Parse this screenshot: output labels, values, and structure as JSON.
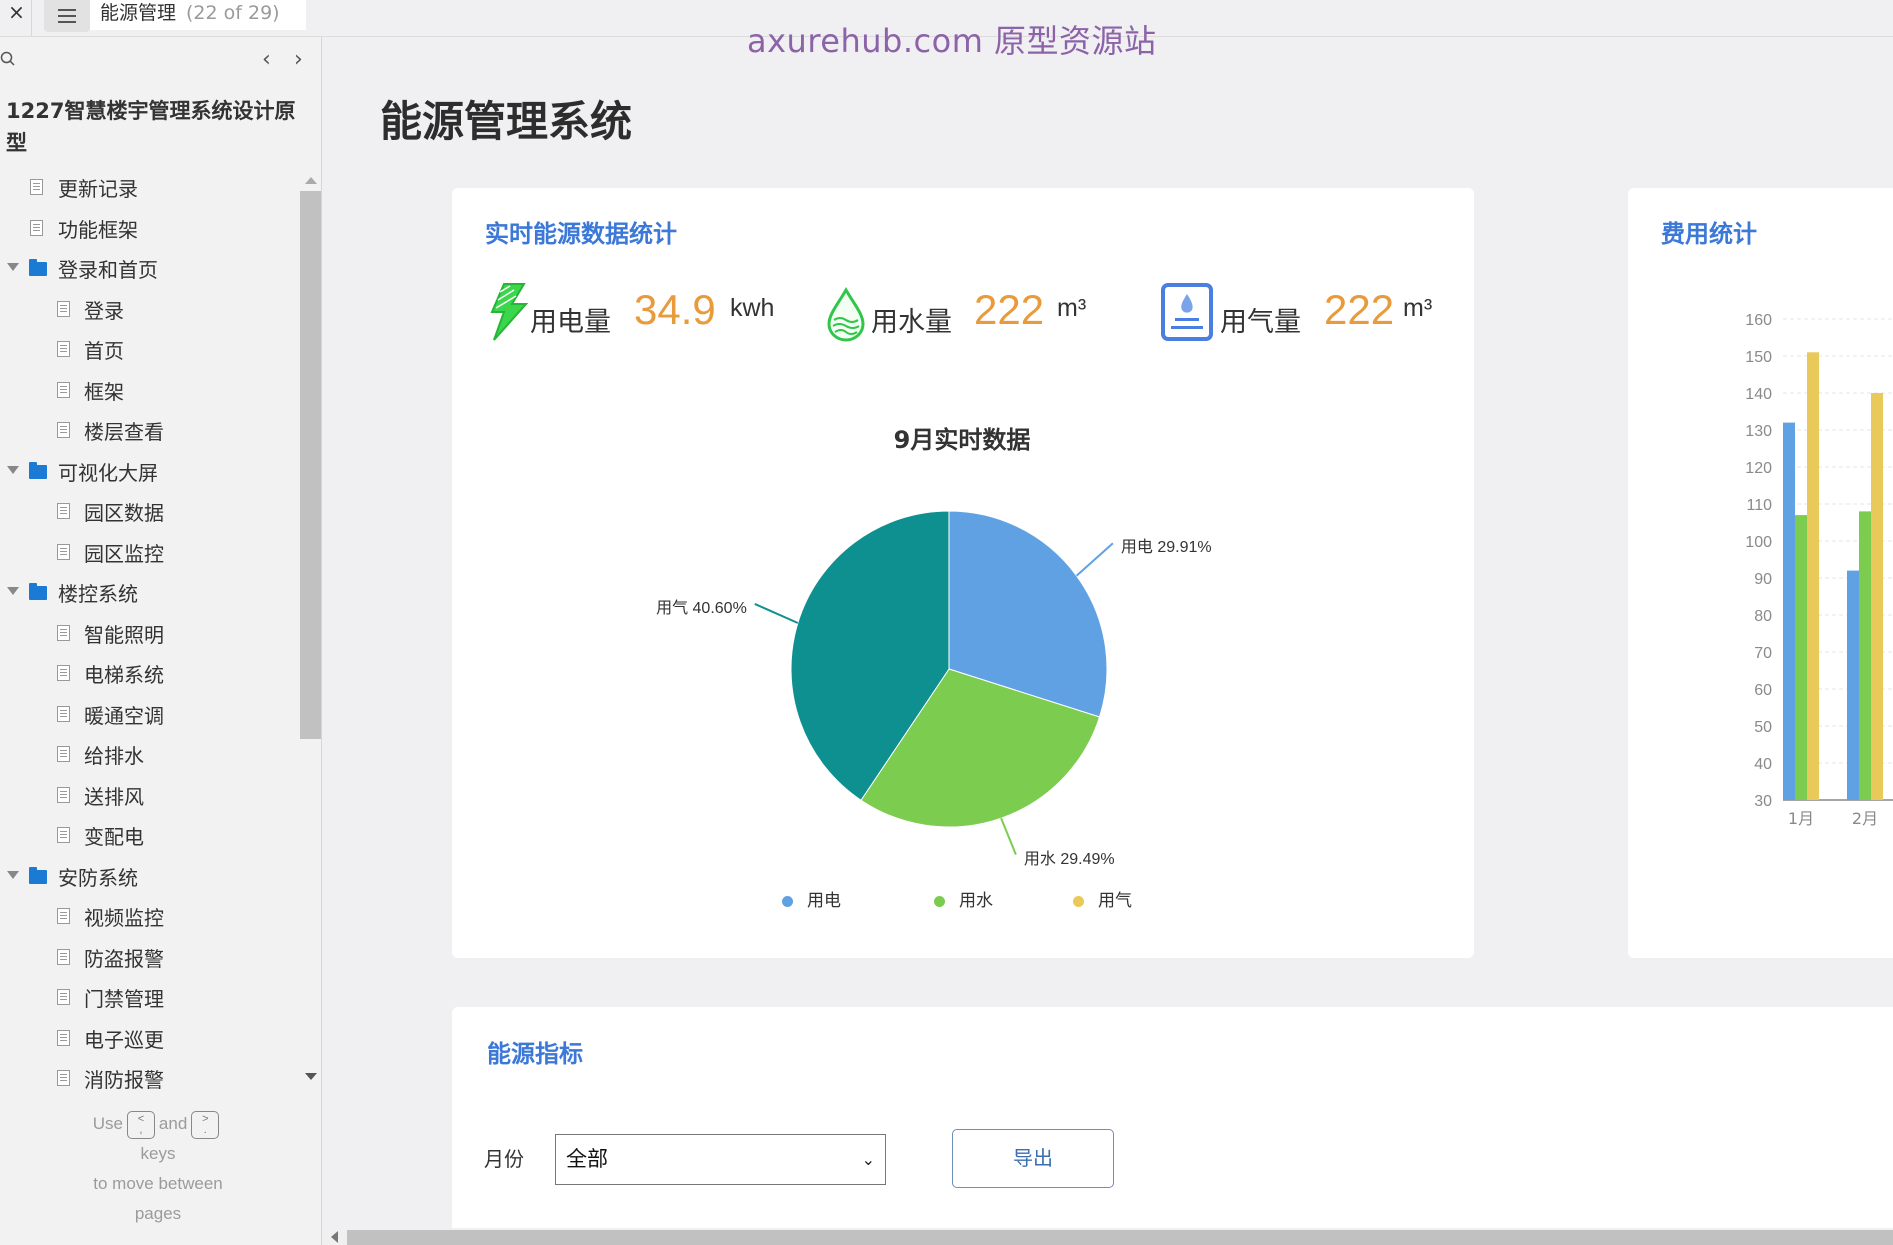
{
  "topbar": {
    "close_label": "×",
    "page_name": "能源管理",
    "page_count": "(22 of 29)",
    "watermark": "axurehub.com 原型资源站"
  },
  "sidebar": {
    "prev_label": "‹",
    "next_label": "›",
    "project_title": "1227智慧楼宇管理系统设计原型",
    "items": [
      {
        "label": "更新记录",
        "type": "page",
        "level": "top"
      },
      {
        "label": "功能框架",
        "type": "page",
        "level": "top"
      },
      {
        "label": "登录和首页",
        "type": "folder",
        "level": "top"
      },
      {
        "label": "登录",
        "type": "page",
        "level": "child"
      },
      {
        "label": "首页",
        "type": "page",
        "level": "child"
      },
      {
        "label": "框架",
        "type": "page",
        "level": "child"
      },
      {
        "label": "楼层查看",
        "type": "page",
        "level": "child"
      },
      {
        "label": "可视化大屏",
        "type": "folder",
        "level": "top"
      },
      {
        "label": "园区数据",
        "type": "page",
        "level": "child"
      },
      {
        "label": "园区监控",
        "type": "page",
        "level": "child"
      },
      {
        "label": "楼控系统",
        "type": "folder",
        "level": "top"
      },
      {
        "label": "智能照明",
        "type": "page",
        "level": "child"
      },
      {
        "label": "电梯系统",
        "type": "page",
        "level": "child"
      },
      {
        "label": "暖通空调",
        "type": "page",
        "level": "child"
      },
      {
        "label": "给排水",
        "type": "page",
        "level": "child"
      },
      {
        "label": "送排风",
        "type": "page",
        "level": "child"
      },
      {
        "label": "变配电",
        "type": "page",
        "level": "child"
      },
      {
        "label": "安防系统",
        "type": "folder",
        "level": "top"
      },
      {
        "label": "视频监控",
        "type": "page",
        "level": "child"
      },
      {
        "label": "防盗报警",
        "type": "page",
        "level": "child"
      },
      {
        "label": "门禁管理",
        "type": "page",
        "level": "child"
      },
      {
        "label": "电子巡更",
        "type": "page",
        "level": "child"
      },
      {
        "label": "消防报警",
        "type": "page",
        "level": "child"
      }
    ],
    "hint": {
      "use": "Use",
      "key_prev_top": "<",
      "key_prev_bottom": ",",
      "and": "and",
      "key_next_top": ">",
      "key_next_bottom": ".",
      "keys": "keys",
      "line2": "to move between",
      "line3": "pages"
    }
  },
  "main": {
    "title": "能源管理系统",
    "realtime_card": {
      "title": "实时能源数据统计",
      "stats": [
        {
          "icon": "lightning-icon",
          "name": "用电量",
          "value": "34.9",
          "unit": "kwh"
        },
        {
          "icon": "water-drop-icon",
          "name": "用水量",
          "value": "222",
          "unit": "m³"
        },
        {
          "icon": "gas-stove-icon",
          "name": "用气量",
          "value": "222",
          "unit": "m³"
        }
      ]
    },
    "cost_card": {
      "title": "费用统计"
    },
    "indicator_card": {
      "title": "能源指标",
      "month_label": "月份",
      "month_selected": "全部",
      "export_label": "导出"
    }
  },
  "colors": {
    "electric": "#5fa1e3",
    "water": "#7ccc50",
    "gas_pie": "#0f9090",
    "gas_bar": "#e8c95a",
    "accent_title": "#3b78d8",
    "value_orange": "#e99a3b"
  },
  "chart_data": [
    {
      "type": "pie",
      "title": "9月实时数据",
      "categories": [
        "用电",
        "用水",
        "用气"
      ],
      "values": [
        29.91,
        29.49,
        40.6
      ],
      "labels": [
        "用电 29.91%",
        "用水  29.49%",
        "用气  40.60%"
      ],
      "legend": [
        "用电",
        "用水",
        "用气"
      ],
      "legend_colors": [
        "#5fa1e3",
        "#7ccc50",
        "#e8c95a"
      ],
      "slice_colors": [
        "#5fa1e3",
        "#7ccc50",
        "#0f9090"
      ],
      "legend_position": "bottom"
    },
    {
      "type": "bar",
      "title": "费用统计",
      "categories": [
        "1月",
        "2月"
      ],
      "series": [
        {
          "name": "用电",
          "values": [
            132,
            92
          ],
          "color": "#5fa1e3"
        },
        {
          "name": "用水",
          "values": [
            107,
            108
          ],
          "color": "#7ccc50"
        },
        {
          "name": "用气",
          "values": [
            151,
            140
          ],
          "color": "#e8c95a"
        }
      ],
      "ylim": [
        30,
        160
      ],
      "yticks": [
        30,
        40,
        50,
        60,
        70,
        80,
        90,
        100,
        110,
        120,
        130,
        140,
        150,
        160
      ],
      "grid": true
    }
  ]
}
